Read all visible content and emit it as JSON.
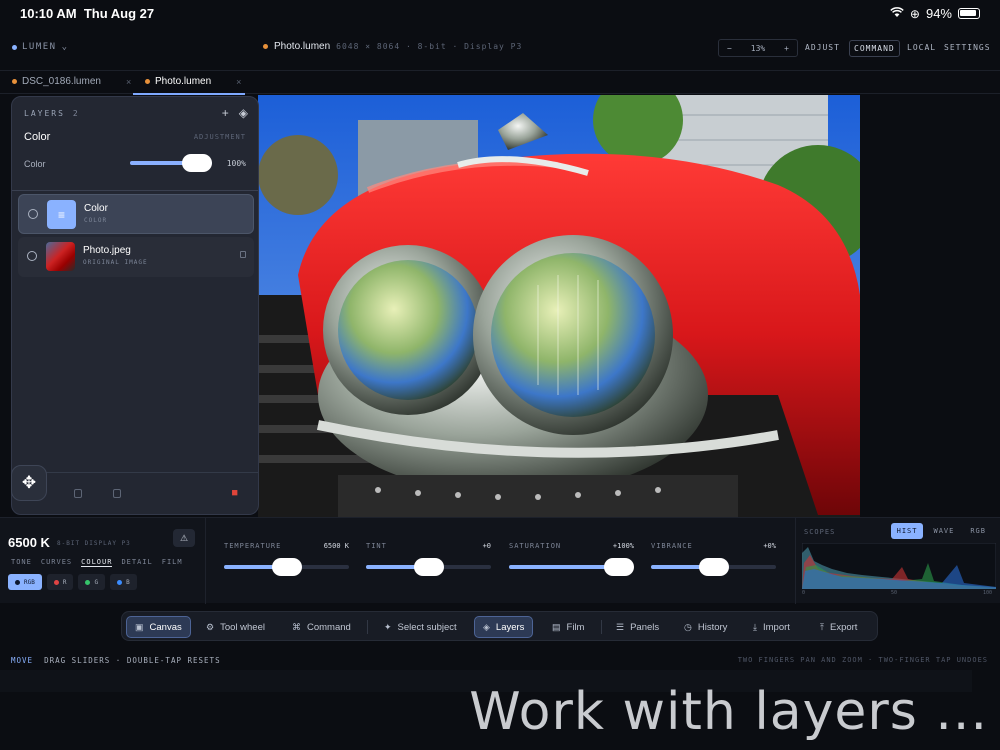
{
  "status_bar": {
    "time": "10:10 AM",
    "date": "Thu Aug 27",
    "battery": "94%"
  },
  "header": {
    "brand": "LUMEN",
    "doc_name": "Photo.lumen",
    "doc_meta": "6048 × 8064 · 8-bit · Display P3",
    "zoom_minus": "−",
    "zoom_value": "13%",
    "zoom_plus": "+",
    "adjust": "ADJUST",
    "command": "COMMAND",
    "local": "LOCAL",
    "settings": "SETTINGS"
  },
  "tabs": [
    {
      "label": "DSC_0186.lumen",
      "close": "×",
      "dot_color": "#e8913a"
    },
    {
      "label": "Photo.lumen",
      "close": "×",
      "dot_color": "#e8913a"
    }
  ],
  "layers_panel": {
    "title": "LAYERS",
    "count": "2",
    "add_icon": "+",
    "adjustment_title": "Color",
    "adjustment_kind": "ADJUSTMENT",
    "opacity_label": "Color",
    "opacity_value": "100%",
    "opacity_fraction": 1.0,
    "layers": [
      {
        "name": "Color",
        "sub": "COLOR",
        "icon": "≡"
      },
      {
        "name": "Photo.jpeg",
        "sub": "ORIGINAL IMAGE"
      }
    ]
  },
  "adjust_strip": {
    "wb_value": "6500 K",
    "wb_meta": "8-BIT DISPLAY P3",
    "warn_icon": "⚠",
    "subtabs": [
      "TONE",
      "CURVES",
      "COLOUR",
      "DETAIL",
      "FILM"
    ],
    "channels": [
      {
        "label": "RGB",
        "color": ""
      },
      {
        "label": "R",
        "color": "#e04444"
      },
      {
        "label": "G",
        "color": "#36c46a"
      },
      {
        "label": "B",
        "color": "#3b8cff"
      }
    ],
    "sliders": [
      {
        "label": "TEMPERATURE",
        "value": "6500 K",
        "level": 0.5
      },
      {
        "label": "TINT",
        "value": "+0",
        "level": 0.5
      },
      {
        "label": "SATURATION",
        "value": "+100%",
        "level": 0.88
      },
      {
        "label": "VIBRANCE",
        "value": "+0%",
        "level": 0.5
      }
    ]
  },
  "scopes": {
    "title": "SCOPES",
    "tabs": [
      "HIST",
      "WAVE",
      "RGB"
    ],
    "axis": [
      "0",
      "50",
      "100"
    ]
  },
  "toolbar": {
    "items": [
      {
        "label": "Canvas",
        "icon": "▣"
      },
      {
        "label": "Tool wheel",
        "icon": "⚙"
      },
      {
        "label": "Command",
        "icon": "⌘"
      },
      {
        "label": "Select subject",
        "icon": "✦"
      },
      {
        "label": "Layers",
        "icon": "◈"
      },
      {
        "label": "Film",
        "icon": "▤"
      },
      {
        "label": "Panels",
        "icon": "☰"
      },
      {
        "label": "History",
        "icon": "◷"
      },
      {
        "label": "Import",
        "icon": "⤓"
      },
      {
        "label": "Export",
        "icon": "⤒"
      }
    ]
  },
  "hints": {
    "mode": "MOVE",
    "left": "DRAG SLIDERS · DOUBLE-TAP RESETS",
    "right": "TWO FINGERS PAN AND ZOOM · TWO-FINGER TAP UNDOES"
  },
  "caption": "Work with layers ...",
  "colors": {
    "accent": "#8ab2ff",
    "danger": "#e0453a",
    "background": "#0b0d12"
  }
}
